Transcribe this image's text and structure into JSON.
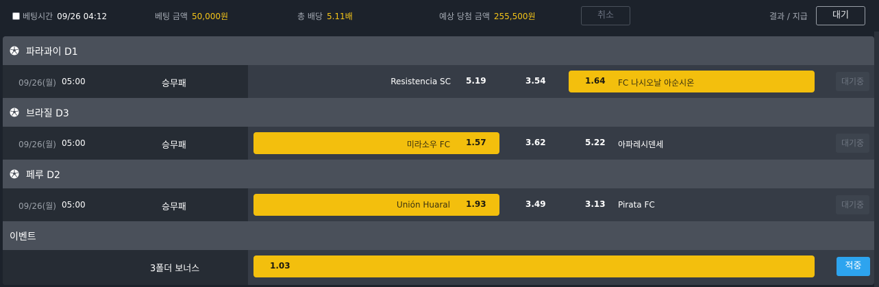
{
  "header": {
    "bet_time_label": "베팅시간",
    "bet_time_value": "09/26 04:12",
    "bet_amount_label": "베팅 금액",
    "bet_amount_value": "50,000원",
    "total_odds_label": "총 배당",
    "total_odds_value": "5.11배",
    "expected_win_label": "예상 당첨 금액",
    "expected_win_value": "255,500원",
    "cancel_label": "취소",
    "result_label": "결과 / 지급",
    "status_label": "대기"
  },
  "colors": {
    "accent_gold": "#f3bf0d",
    "highlight_text": "#f5c518",
    "win_blue": "#2da4ef"
  },
  "leagues": [
    {
      "name": "파라과이 D1",
      "icon": "soccer-ball-icon",
      "match": {
        "date": "09/26(월)",
        "time": "05:00",
        "market": "승무패",
        "home": "Resistencia SC",
        "home_odds": "5.19",
        "draw_odds": "3.54",
        "away_odds": "1.64",
        "away": "FC 나시오날 아순시온",
        "selected": "away",
        "status": "대기중"
      }
    },
    {
      "name": "브라질 D3",
      "icon": "soccer-ball-icon",
      "match": {
        "date": "09/26(월)",
        "time": "05:00",
        "market": "승무패",
        "home": "미라소우 FC",
        "home_odds": "1.57",
        "draw_odds": "3.62",
        "away_odds": "5.22",
        "away": "아파레시덴세",
        "selected": "home",
        "status": "대기중"
      }
    },
    {
      "name": "페루 D2",
      "icon": "soccer-ball-icon",
      "match": {
        "date": "09/26(월)",
        "time": "05:00",
        "market": "승무패",
        "home": "Unión Huaral",
        "home_odds": "1.93",
        "draw_odds": "3.49",
        "away_odds": "3.13",
        "away": "Pirata FC",
        "selected": "home",
        "status": "대기중"
      }
    }
  ],
  "event": {
    "title": "이벤트",
    "bonus_name": "3폴더 보너스",
    "bonus_odds": "1.03",
    "status": "적중"
  }
}
